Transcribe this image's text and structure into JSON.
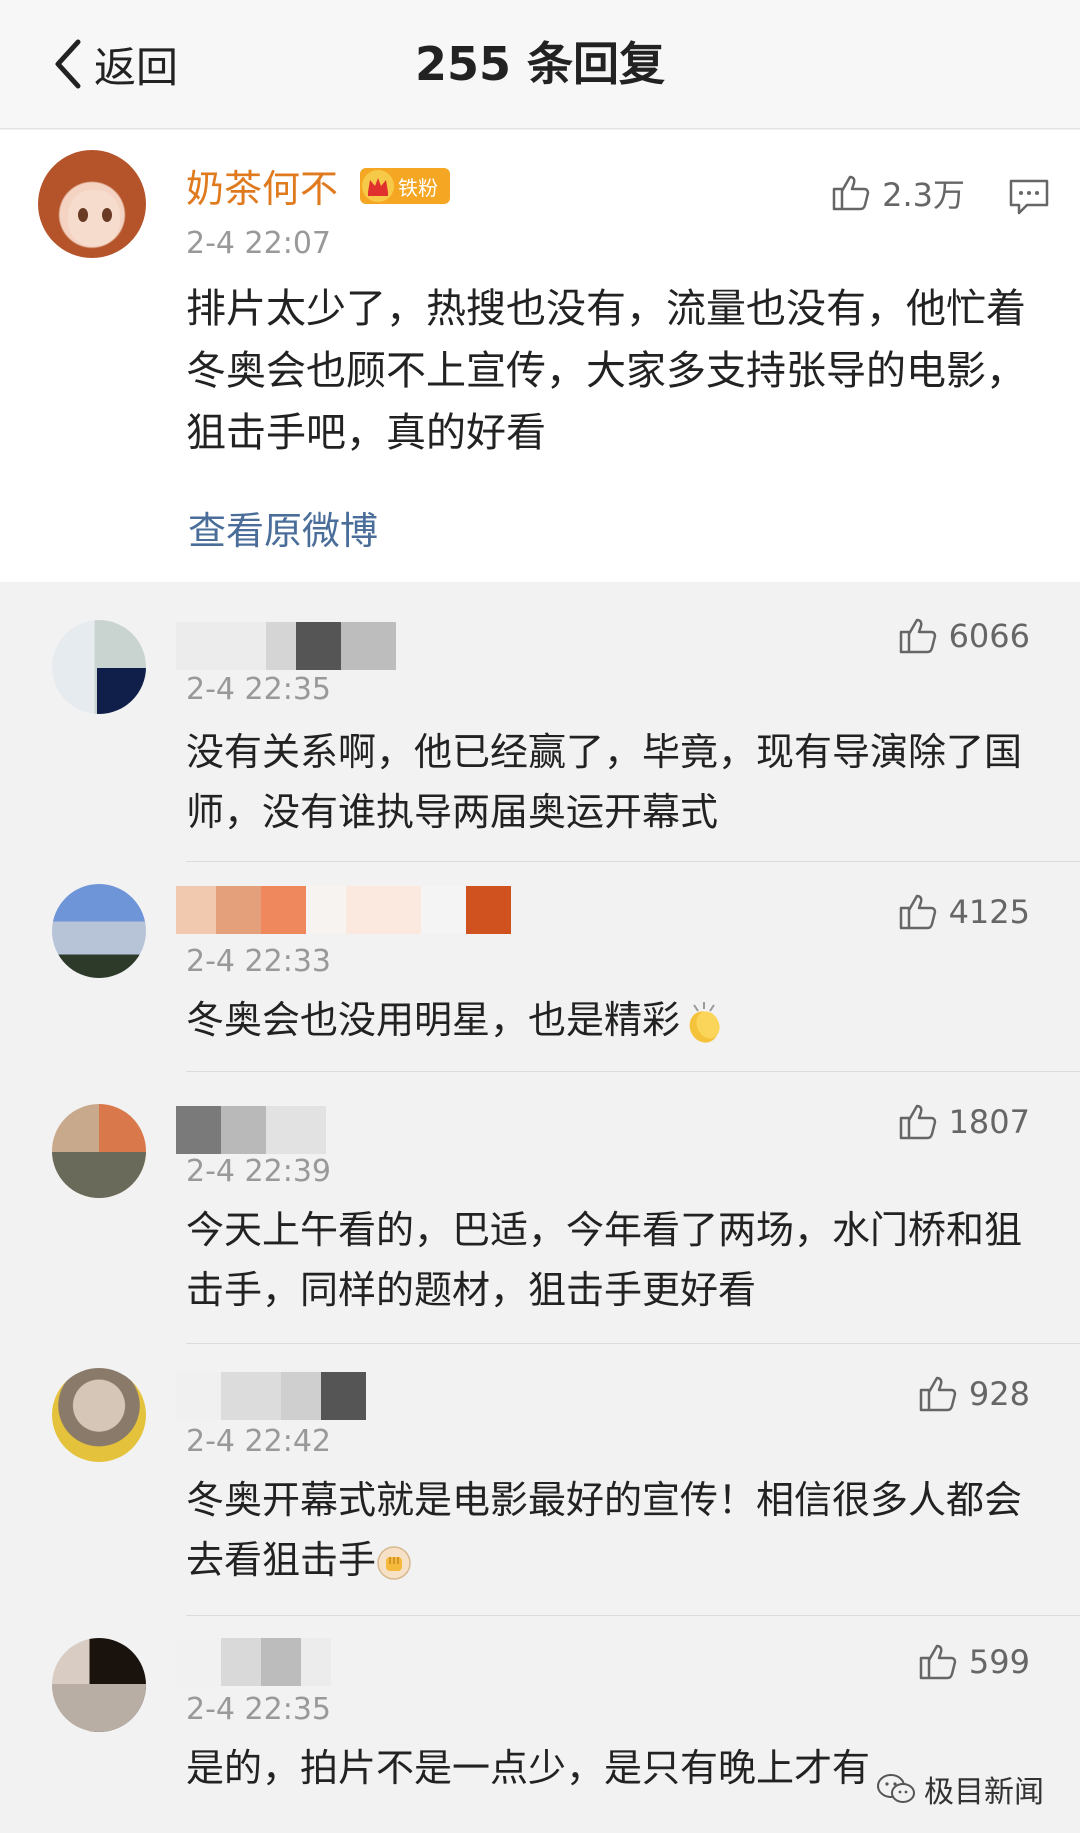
{
  "nav": {
    "back_label": "返回",
    "title": "255 条回复"
  },
  "main_post": {
    "user_name": "奶茶何不",
    "fan_badge": "铁粉",
    "like_count": "2.3万",
    "time": "2-4 22:07",
    "text": "排片太少了，热搜也没有，流量也没有，他忙着冬奥会也顾不上宣传，大家多支持张导的电影，狙击手吧，真的好看",
    "view_original": "查看原微博"
  },
  "replies": [
    {
      "time": "2-4 22:35",
      "likes": "6066",
      "text": "没有关系啊，他已经赢了，毕竟，现有导演除了国师，没有谁执导两届奥运开幕式"
    },
    {
      "time": "2-4 22:33",
      "likes": "4125",
      "text": "冬奥会也没用明星，也是精彩"
    },
    {
      "time": "2-4 22:39",
      "likes": "1807",
      "text": "今天上午看的，巴适，今年看了两场，水门桥和狙击手，同样的题材，狙击手更好看"
    },
    {
      "time": "2-4 22:42",
      "likes": "928",
      "text": "冬奥开幕式就是电影最好的宣传！相信很多人都会去看狙击手"
    },
    {
      "time": "2-4 22:35",
      "likes": "599",
      "text": "是的，拍片不是一点少，是只有晚上才有"
    }
  ],
  "watermark": "极目新闻",
  "colors": {
    "name_orange": "#e07a1f",
    "link_blue": "#4a6e99",
    "badge": "#f5a623"
  },
  "icons": [
    "back-chevron-icon",
    "thumb-up-icon",
    "comment-icon",
    "crown-icon",
    "clap-emoji",
    "fist-emoji",
    "watermark-logo-icon"
  ]
}
